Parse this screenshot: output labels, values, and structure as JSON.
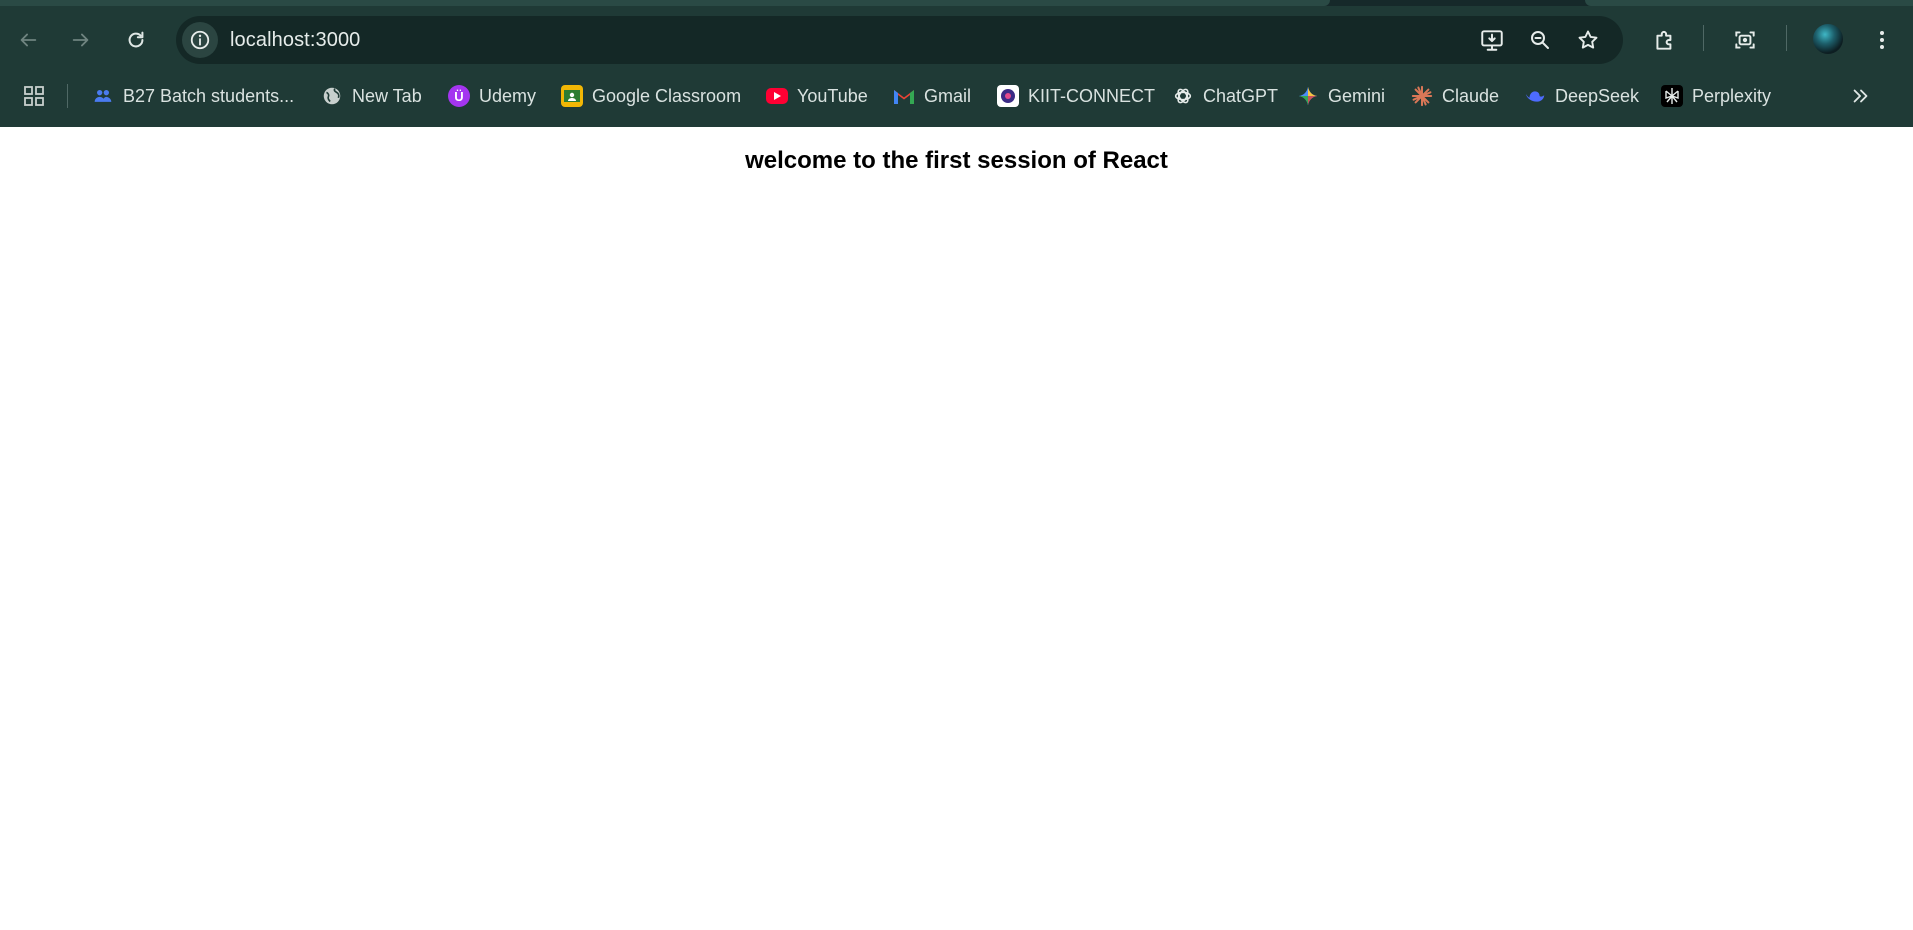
{
  "browser": {
    "url": "localhost:3000",
    "icons": {
      "back": "arrow-left-icon",
      "forward": "arrow-right-icon",
      "reload": "reload-icon",
      "site_info": "info-icon",
      "install": "install-app-icon",
      "zoom": "zoom-icon",
      "bookmark": "star-icon",
      "extensions": "puzzle-icon",
      "screenshot": "camera-icon",
      "menu": "three-dots-icon"
    },
    "colors": {
      "chrome": "#1f3a36",
      "omnibox": "#142826",
      "text": "#d9e2e0"
    }
  },
  "bookmarks": [
    {
      "label": "B27 Batch students...",
      "icon": "people-icon",
      "color": "#4a7bf0"
    },
    {
      "label": "New Tab",
      "icon": "globe-icon",
      "color": "#c8d0ce"
    },
    {
      "label": "Udemy",
      "icon": "udemy-icon",
      "color": "#a435f0"
    },
    {
      "label": "Google Classroom",
      "icon": "classroom-icon",
      "color": "#f2b705"
    },
    {
      "label": "YouTube",
      "icon": "youtube-icon",
      "color": "#ff0033"
    },
    {
      "label": "Gmail",
      "icon": "gmail-icon",
      "color": "#ea4335"
    },
    {
      "label": "KIIT-CONNECT",
      "icon": "kiit-icon",
      "color": "#3b2b86"
    },
    {
      "label": "ChatGPT",
      "icon": "chatgpt-icon",
      "color": "#e6ecea"
    },
    {
      "label": "Gemini",
      "icon": "gemini-icon",
      "color": "#4c8df6"
    },
    {
      "label": "Claude",
      "icon": "claude-icon",
      "color": "#d97757"
    },
    {
      "label": "DeepSeek",
      "icon": "deepseek-icon",
      "color": "#4d6bfe"
    },
    {
      "label": "Perplexity",
      "icon": "perplexity-icon",
      "color": "#20808d"
    }
  ],
  "page": {
    "heading": "welcome to the first session of React"
  }
}
